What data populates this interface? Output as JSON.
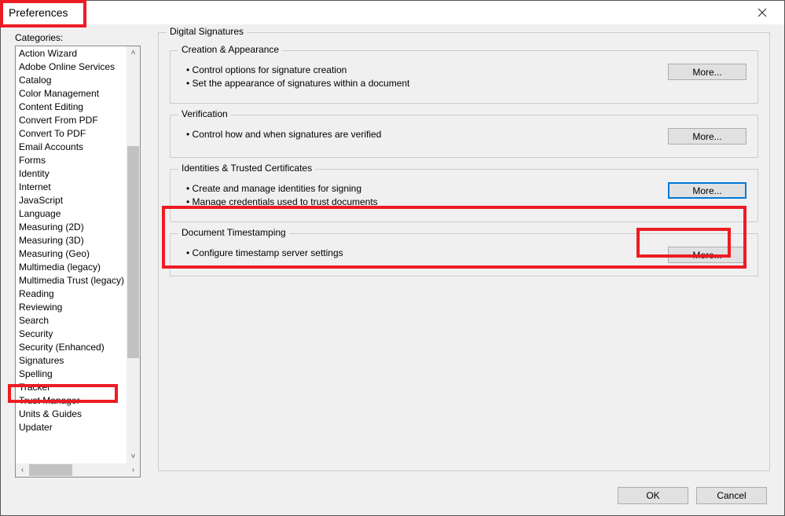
{
  "dialog": {
    "title": "Preferences",
    "categories_label": "Categories:",
    "ok": "OK",
    "cancel": "Cancel"
  },
  "categories": [
    "Action Wizard",
    "Adobe Online Services",
    "Catalog",
    "Color Management",
    "Content Editing",
    "Convert From PDF",
    "Convert To PDF",
    "Email Accounts",
    "Forms",
    "Identity",
    "Internet",
    "JavaScript",
    "Language",
    "Measuring (2D)",
    "Measuring (3D)",
    "Measuring (Geo)",
    "Multimedia (legacy)",
    "Multimedia Trust (legacy)",
    "Reading",
    "Reviewing",
    "Search",
    "Security",
    "Security (Enhanced)",
    "Signatures",
    "Spelling",
    "Tracker",
    "Trust Manager",
    "Units & Guides",
    "Updater"
  ],
  "selected_category_index": 23,
  "panel": {
    "outer_title": "Digital Signatures",
    "groups": [
      {
        "title": "Creation & Appearance",
        "bullets": [
          "Control options for signature creation",
          "Set the appearance of signatures within a document"
        ],
        "button": "More..."
      },
      {
        "title": "Verification",
        "bullets": [
          "Control how and when signatures are verified"
        ],
        "button": "More..."
      },
      {
        "title": "Identities & Trusted Certificates",
        "bullets": [
          "Create and manage identities for signing",
          "Manage credentials used to trust documents"
        ],
        "button": "More..."
      },
      {
        "title": "Document Timestamping",
        "bullets": [
          "Configure timestamp server settings"
        ],
        "button": "More..."
      }
    ]
  }
}
